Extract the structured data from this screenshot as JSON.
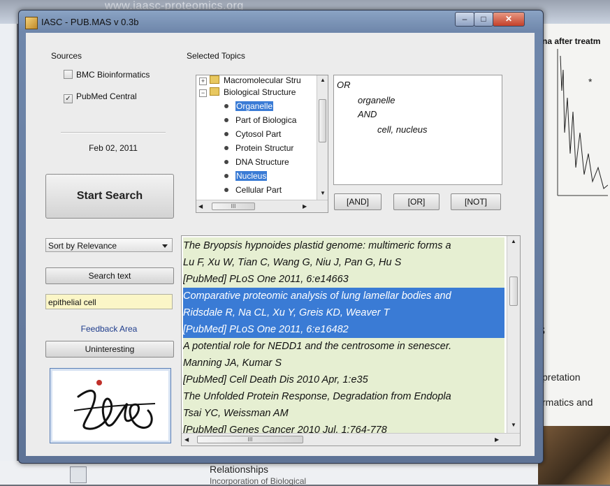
{
  "background": {
    "url": "www.iaasc-proteomics.org",
    "right_heading": "na after treatm",
    "right_letter": "s",
    "right_text_1": "pretation",
    "right_text_2": "rmatics and",
    "bottom_text_1": "Relationships",
    "bottom_text_2": "Incorporation of Biological"
  },
  "window": {
    "title": "IASC - PUB.MAS v 0.3b",
    "controls": {
      "minimize": "–",
      "maximize": "□",
      "close": "✕"
    }
  },
  "sources": {
    "label": "Sources",
    "items": [
      {
        "label": "BMC Bioinformatics",
        "checked": false
      },
      {
        "label": "PubMed Central",
        "checked": true
      }
    ]
  },
  "date": "Feb 02, 2011",
  "start_button": "Start Search",
  "topics": {
    "label": "Selected Topics",
    "tree": [
      {
        "label": "Macromolecular Stru",
        "level": 0,
        "expander": "+",
        "selected": false
      },
      {
        "label": "Biological Structure",
        "level": 0,
        "expander": "−",
        "selected": false
      },
      {
        "label": "Organelle",
        "level": 1,
        "selected": true
      },
      {
        "label": "Part of Biologica",
        "level": 1,
        "selected": false
      },
      {
        "label": "Cytosol Part",
        "level": 1,
        "selected": false
      },
      {
        "label": "Protein Structur",
        "level": 1,
        "selected": false
      },
      {
        "label": "DNA Structure",
        "level": 1,
        "selected": false
      },
      {
        "label": "Nucleus",
        "level": 1,
        "selected": true
      },
      {
        "label": "Cellular Part",
        "level": 1,
        "selected": false
      }
    ],
    "hscroll_grip": "III"
  },
  "query": {
    "lines": [
      "OR",
      "organelle",
      "AND",
      "cell, nucleus"
    ]
  },
  "operators": {
    "and": "[AND]",
    "or": "[OR]",
    "not": "[NOT]"
  },
  "sort": {
    "selected": "Sort by Relevance"
  },
  "search_text_button": "Search text",
  "search_input": {
    "value": "epithelial cell"
  },
  "feedback_label": "Feedback Area",
  "uninteresting_button": "Uninteresting",
  "logo_text": "IASC",
  "results": {
    "lines": [
      {
        "text": "The Bryopsis hypnoides plastid genome: multimeric forms a",
        "style": "gr"
      },
      {
        "text": "Lu F, Xu W, Tian C, Wang G, Niu J, Pan G, Hu S",
        "style": "gr"
      },
      {
        "text": "     [PubMed] PLoS One 2011, 6:e14663",
        "style": "gr"
      },
      {
        "text": "Comparative proteomic analysis of lung lamellar bodies and",
        "style": "hl"
      },
      {
        "text": "Ridsdale R, Na CL, Xu Y, Greis KD, Weaver T",
        "style": "hl"
      },
      {
        "text": "     [PubMed] PLoS One 2011, 6:e16482",
        "style": "hl"
      },
      {
        "text": "A potential role for NEDD1 and the centrosome in senescer.",
        "style": "gr"
      },
      {
        "text": "Manning JA, Kumar S",
        "style": "gr"
      },
      {
        "text": "     [PubMed] Cell Death Dis 2010 Apr, 1:e35",
        "style": "gr"
      },
      {
        "text": "The Unfolded Protein Response, Degradation from Endopla",
        "style": "gr"
      },
      {
        "text": "Tsai YC, Weissman AM",
        "style": "gr"
      },
      {
        "text": "     [PubMed] Genes Cancer 2010 Jul, 1:764-778",
        "style": "gr"
      }
    ],
    "hscroll_grip": "III"
  }
}
